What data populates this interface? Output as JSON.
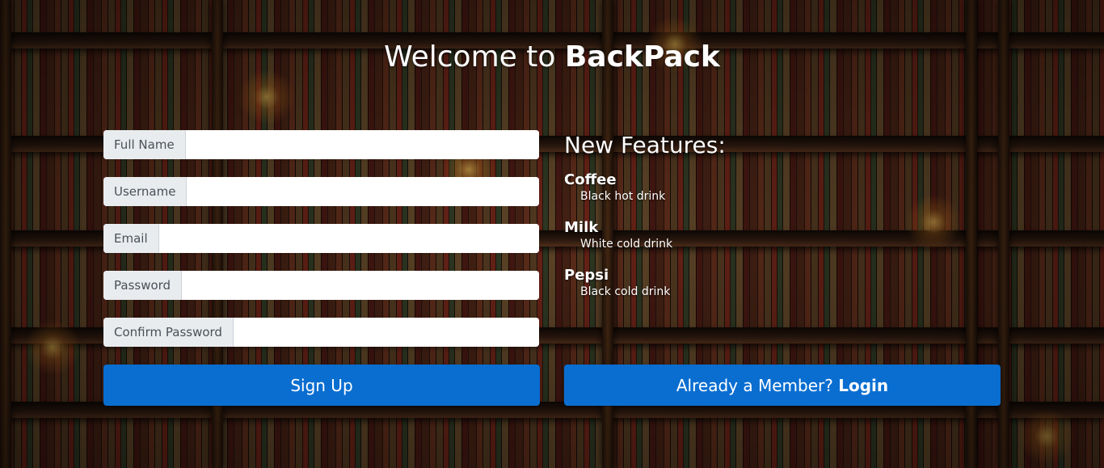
{
  "page": {
    "title_prefix": "Welcome to",
    "title_brand": "BackPack"
  },
  "form": {
    "fields": [
      {
        "label": "Full Name",
        "value": ""
      },
      {
        "label": "Username",
        "value": ""
      },
      {
        "label": "Email",
        "value": ""
      },
      {
        "label": "Password",
        "value": ""
      },
      {
        "label": "Confirm Password",
        "value": ""
      }
    ],
    "signup_label": "Sign Up"
  },
  "features": {
    "heading": "New Features:",
    "items": [
      {
        "name": "Coffee",
        "description": "Black hot drink"
      },
      {
        "name": "Milk",
        "description": "White cold drink"
      },
      {
        "name": "Pepsi",
        "description": "Black cold drink"
      }
    ]
  },
  "login": {
    "prefix": "Already a Member?",
    "link_label": "Login"
  },
  "colors": {
    "accent": "#0a6ed1",
    "label_bg": "#e9ecef"
  }
}
